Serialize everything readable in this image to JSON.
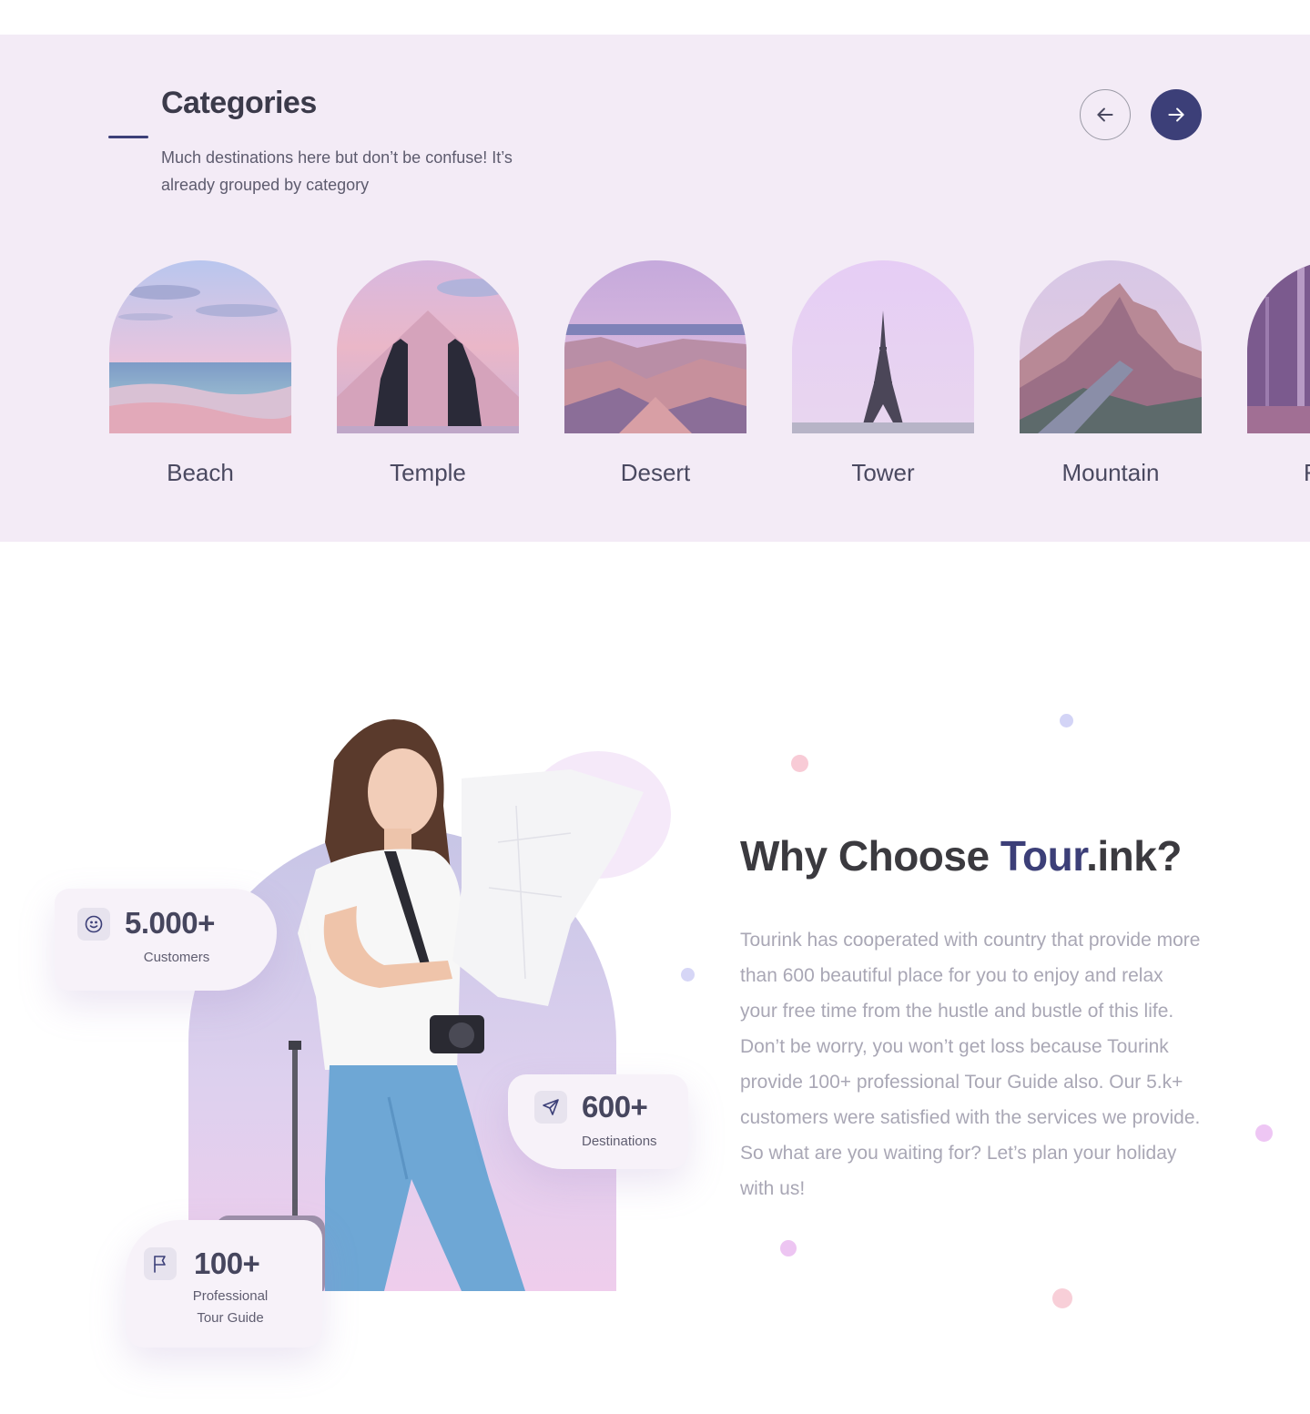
{
  "categories": {
    "title": "Categories",
    "subtitle": "Much destinations here but don’t be confuse! It’s already grouped by category",
    "prev_icon": "arrow-left-icon",
    "next_icon": "arrow-right-icon",
    "items": [
      {
        "label": "Beach"
      },
      {
        "label": "Temple"
      },
      {
        "label": "Desert"
      },
      {
        "label": "Tower"
      },
      {
        "label": "Mountain"
      },
      {
        "label": "F"
      }
    ]
  },
  "why": {
    "title_prefix": "Why Choose ",
    "brand": "Tour",
    "title_suffix": ".ink?",
    "body": "Tourink has cooperated with country that provide more than 600 beautiful place for you to enjoy and relax your free time from the hustle and bustle of this life. Don’t be worry, you won’t get loss because Tourink provide 100+ professional Tour Guide also. Our 5.k+ customers were satisfied with the services we provide. So what are you waiting for? Let’s plan your holiday with us!"
  },
  "stats": {
    "customers": {
      "value": "5.000+",
      "label": "Customers",
      "icon": "smile-icon"
    },
    "destinations": {
      "value": "600+",
      "label": "Destinations",
      "icon": "send-icon"
    },
    "guides": {
      "value": "100+",
      "label_line1": "Professional",
      "label_line2": "Tour Guide",
      "icon": "flag-icon"
    }
  },
  "colors": {
    "accent": "#3c3f78",
    "section_bg": "#f3ebf6",
    "body_text": "#a9a7b5"
  }
}
